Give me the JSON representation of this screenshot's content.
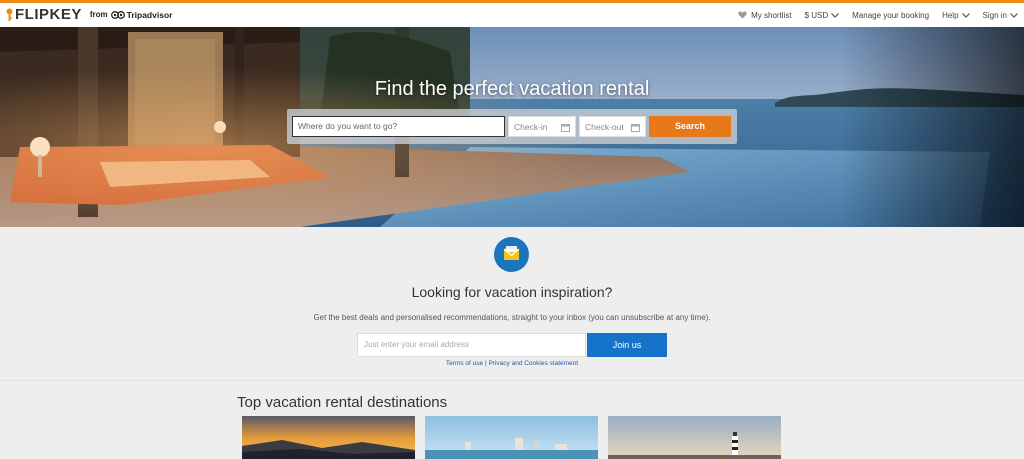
{
  "brand": {
    "name": "FLIPKEY",
    "from_text": "from",
    "partner": "Tripadvisor",
    "accent_color": "#f08a17"
  },
  "nav": {
    "shortlist": "My shortlist",
    "currency": "$ USD",
    "manage": "Manage your booking",
    "help": "Help",
    "signin": "Sign in"
  },
  "hero": {
    "title": "Find the perfect vacation rental",
    "where_placeholder": "Where do you want to go?",
    "checkin": "Check-in",
    "checkout": "Check-out",
    "search_label": "Search",
    "search_color": "#e8791a"
  },
  "newsletter": {
    "icon": "envelope-icon",
    "title": "Looking for vacation inspiration?",
    "subtitle": "Get the best deals and personalised recommendations, straight to your inbox (you can unsubscribe at any time).",
    "email_placeholder": "Just enter your email address",
    "join_label": "Join us",
    "join_color": "#1573c9",
    "terms_link": "Terms of use",
    "separator": "|",
    "privacy_link": "Privacy and Cookies statement"
  },
  "destinations": {
    "title": "Top vacation rental destinations",
    "cards": [
      {
        "image": "sunset-mountains-image"
      },
      {
        "image": "beach-city-image"
      },
      {
        "image": "lighthouse-image"
      }
    ]
  }
}
